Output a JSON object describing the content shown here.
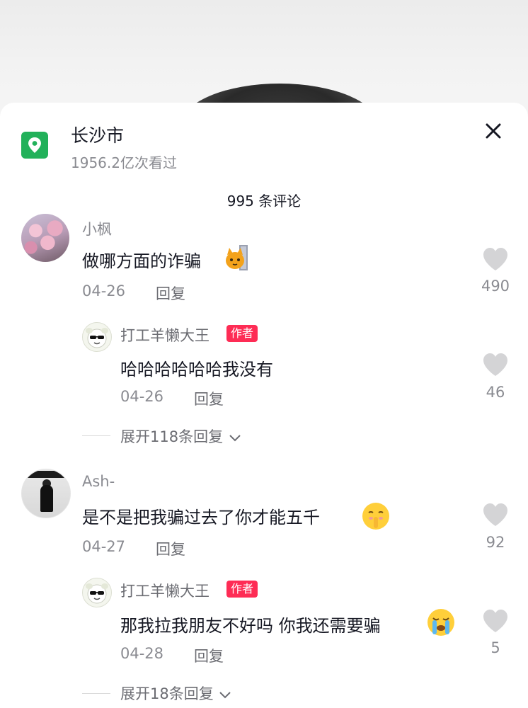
{
  "location": {
    "icon": "location-pin-icon",
    "title": "长沙市",
    "views": "1956.2亿次看过"
  },
  "comments_count_title": "995 条评论",
  "comments": [
    {
      "user": "小枫",
      "text": "做哪方面的诈骗",
      "emoji": "cat-emoji",
      "date": "04-26",
      "reply_label": "回复",
      "likes": "490",
      "replies": [
        {
          "user": "打工羊懒大王",
          "badge": "作者",
          "text": "哈哈哈哈哈哈我没有",
          "date": "04-26",
          "reply_label": "回复",
          "likes": "46"
        }
      ],
      "expand_label": "展开118条回复"
    },
    {
      "user": "Ash-",
      "text": "是不是把我骗过去了你才能五千",
      "emoji": "shushing-face-emoji",
      "date": "04-27",
      "reply_label": "回复",
      "likes": "92",
      "replies": [
        {
          "user": "打工羊懒大王",
          "badge": "作者",
          "text": "那我拉我朋友不好吗 你我还需要骗",
          "emoji": "crying-face-emoji",
          "date": "04-28",
          "reply_label": "回复",
          "likes": "5"
        }
      ],
      "expand_label": "展开18条回复"
    }
  ],
  "colors": {
    "accent_badge": "#fe2c55",
    "location_icon_bg": "#22b15a",
    "secondary_text": "#8a8b91"
  }
}
